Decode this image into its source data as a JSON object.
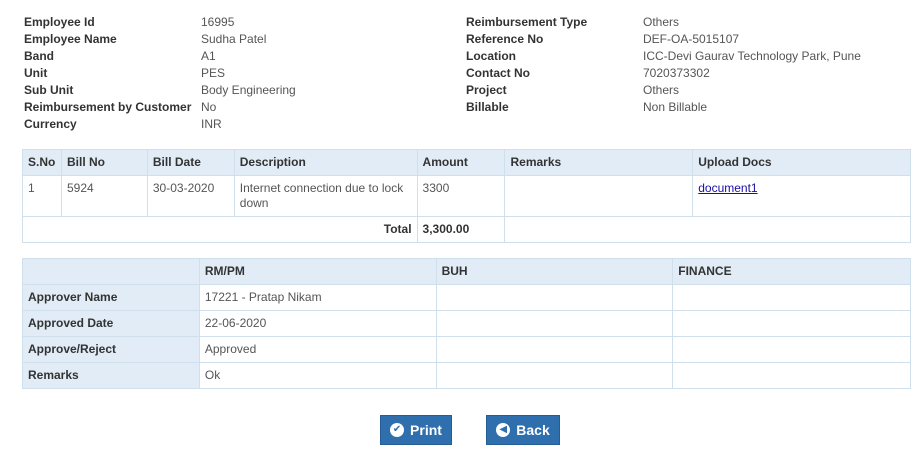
{
  "employee_info": {
    "left": [
      {
        "label": "Employee Id",
        "value": "16995"
      },
      {
        "label": "Employee Name",
        "value": "Sudha Patel"
      },
      {
        "label": "Band",
        "value": "A1"
      },
      {
        "label": "Unit",
        "value": "PES"
      },
      {
        "label": "Sub Unit",
        "value": "Body Engineering"
      },
      {
        "label": "Reimbursement by Customer",
        "value": "No"
      },
      {
        "label": "Currency",
        "value": "INR"
      }
    ],
    "right": [
      {
        "label": "Reimbursement Type",
        "value": "Others"
      },
      {
        "label": "Reference No",
        "value": "DEF-OA-5015107"
      },
      {
        "label": "Location",
        "value": "ICC-Devi Gaurav Technology Park, Pune"
      },
      {
        "label": "Contact No",
        "value": "7020373302"
      },
      {
        "label": "Project",
        "value": "Others"
      },
      {
        "label": "Billable",
        "value": "Non Billable"
      }
    ]
  },
  "bills": {
    "headers": [
      "S.No",
      "Bill No",
      "Bill Date",
      "Description",
      "Amount",
      "Remarks",
      "Upload Docs"
    ],
    "rows": [
      {
        "sno": "1",
        "bill_no": "5924",
        "bill_date": "30-03-2020",
        "description": "Internet connection due to lock down",
        "amount": "3300",
        "remarks": "",
        "doc": "document1"
      }
    ],
    "total_label": "Total",
    "total_value": "3,300.00"
  },
  "approvals": {
    "headers": [
      "",
      "RM/PM",
      "BUH",
      "FINANCE"
    ],
    "rows": [
      {
        "label": "Approver Name",
        "rmpm": "17221 - Pratap Nikam",
        "buh": "",
        "finance": ""
      },
      {
        "label": "Approved Date",
        "rmpm": "22-06-2020",
        "buh": "",
        "finance": ""
      },
      {
        "label": "Approve/Reject",
        "rmpm": "Approved",
        "buh": "",
        "finance": ""
      },
      {
        "label": "Remarks",
        "rmpm": "Ok",
        "buh": "",
        "finance": ""
      }
    ]
  },
  "buttons": {
    "print_label": "Print",
    "print_icon": "check-circle-icon",
    "back_label": "Back",
    "back_icon": "arrow-left-circle-icon"
  },
  "colors": {
    "header_bg": "#e2ecf6",
    "border": "#cfdfec",
    "button_bg": "#2f6fad",
    "link": "#1a0dab"
  }
}
